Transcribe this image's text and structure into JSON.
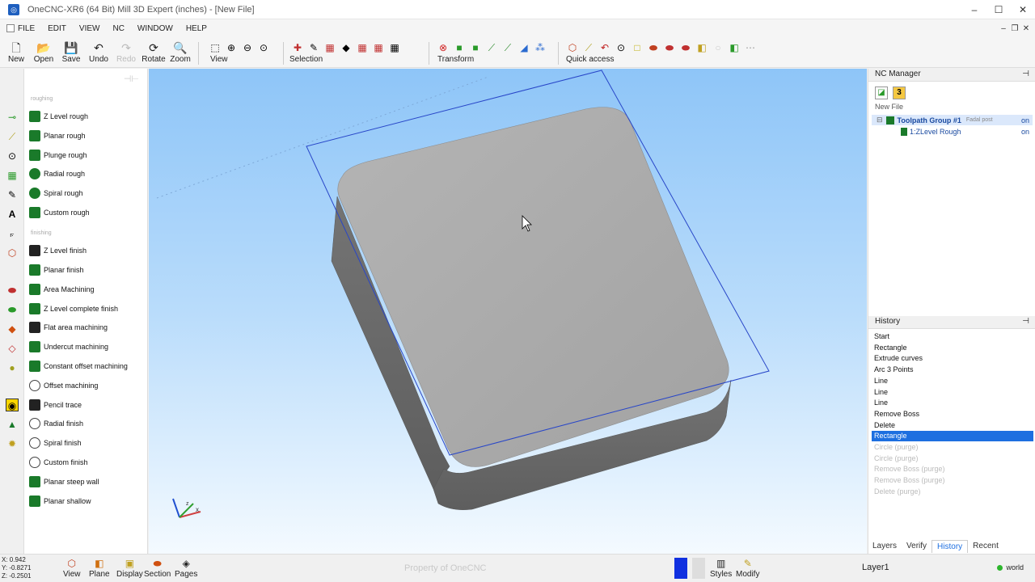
{
  "window": {
    "title": "OneCNC-XR6 (64 Bit) Mill 3D Expert (inches) - [New File]"
  },
  "menu": [
    "FILE",
    "EDIT",
    "VIEW",
    "NC",
    "WINDOW",
    "HELP"
  ],
  "toolbar": {
    "new": "New",
    "open": "Open",
    "save": "Save",
    "undo": "Undo",
    "redo": "Redo",
    "rotate": "Rotate",
    "zoom": "Zoom",
    "view": "View",
    "selection": "Selection",
    "transform": "Transform",
    "quick_access": "Quick access"
  },
  "toolpaths": {
    "roughing_label": "roughing",
    "roughing": [
      "Z Level rough",
      "Planar rough",
      "Plunge rough",
      "Radial rough",
      "Spiral rough",
      "Custom rough"
    ],
    "finishing_label": "finishing",
    "finishing": [
      "Z Level finish",
      "Planar finish",
      "Area Machining",
      "Z Level complete finish",
      "Flat area machining",
      "Undercut machining",
      "Constant offset machining",
      "Offset machining",
      "Pencil trace",
      "Radial finish",
      "Spiral finish",
      "Custom finish",
      "Planar steep wall",
      "Planar shallow"
    ]
  },
  "nc_manager": {
    "title": "NC Manager",
    "icon_number": "3",
    "new_file": "New File",
    "group": {
      "label": "Toolpath Group #1",
      "post": "Fadal post",
      "state": "on"
    },
    "operation": {
      "label": "1:ZLevel Rough",
      "state": "on"
    }
  },
  "history": {
    "title": "History",
    "items": [
      {
        "label": "Start",
        "state": "normal"
      },
      {
        "label": "Rectangle",
        "state": "normal"
      },
      {
        "label": "Extrude curves",
        "state": "normal"
      },
      {
        "label": "Arc 3 Points",
        "state": "normal"
      },
      {
        "label": "Line",
        "state": "normal"
      },
      {
        "label": "Line",
        "state": "normal"
      },
      {
        "label": "Line",
        "state": "normal"
      },
      {
        "label": "Remove Boss",
        "state": "normal"
      },
      {
        "label": "Delete",
        "state": "normal"
      },
      {
        "label": "Rectangle",
        "state": "selected"
      },
      {
        "label": "Circle (purge)",
        "state": "purge"
      },
      {
        "label": "Circle (purge)",
        "state": "purge"
      },
      {
        "label": "Remove Boss (purge)",
        "state": "purge"
      },
      {
        "label": "Remove Boss (purge)",
        "state": "purge"
      },
      {
        "label": "Delete (purge)",
        "state": "purge"
      }
    ]
  },
  "right_tabs": [
    "Layers",
    "Verify",
    "History",
    "Recent"
  ],
  "status": {
    "x": "X: 0.942",
    "y": "Y: -0.8271",
    "z": "Z: -0.2501",
    "view": "View",
    "plane": "Plane",
    "display": "Display",
    "section": "Section",
    "pages": "Pages",
    "watermark": "Property of OneCNC",
    "styles": "Styles",
    "modify": "Modify",
    "layer": "Layer1",
    "world": "world"
  },
  "colors": {
    "accent": "#1e6fe0",
    "toolpath_green": "#1a7a2a",
    "viewport_top": "#8ec5f8",
    "part_gray": "#a7a7a7"
  }
}
